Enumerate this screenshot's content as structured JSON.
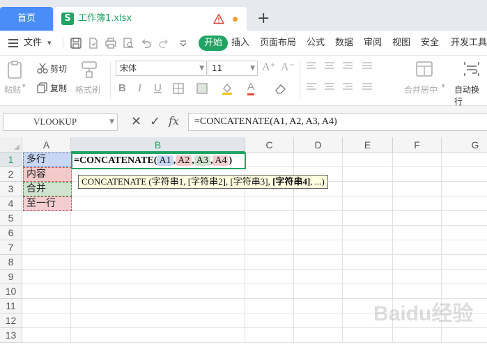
{
  "tabs": {
    "home_label": "首页",
    "doc_title": "工作簿1.xlsx",
    "doc_icon_letter": "S",
    "new_tab_icon": "+"
  },
  "menu": {
    "file_label": "文件",
    "tabs": [
      "开始",
      "插入",
      "页面布局",
      "公式",
      "数据",
      "审阅",
      "视图",
      "安全",
      "开发工具"
    ]
  },
  "ribbon": {
    "paste_label": "粘贴",
    "cut_label": "剪切",
    "copy_label": "复制",
    "format_painter_label": "格式刷",
    "font_name": "宋体",
    "font_size": "11",
    "merge_label": "合并居中",
    "wrap_label": "自动换行"
  },
  "formula_bar": {
    "name_box": "VLOOKUP",
    "fx_label": "fx",
    "formula": "=CONCATENATE(A1, A2, A3, A4)"
  },
  "sheet": {
    "columns": [
      "A",
      "B",
      "C",
      "D",
      "E",
      "F",
      "G"
    ],
    "rows": [
      "1",
      "2",
      "3",
      "4",
      "5",
      "6",
      "7",
      "8",
      "9",
      "10",
      "11",
      "12",
      "13"
    ],
    "cells_A": [
      "多行",
      "内容",
      "合并",
      "至一行"
    ],
    "edit_prefix": "=CONCATENATE(",
    "edit_refs": [
      "A1",
      "A2",
      "A3",
      "A4"
    ],
    "edit_suffix": ")",
    "ref_colors": [
      "#c9d7f5",
      "#f4c9c9",
      "#cfe3cf",
      "#f4cdd0"
    ],
    "tooltip": {
      "func": "CONCATENATE",
      "arg1": "字符串1",
      "arg2": "[字符串2]",
      "arg3": "[字符串3]",
      "arg4": "[字符串4]",
      "tail": "..."
    },
    "watermark": "Baidu经验"
  },
  "colors": {
    "accent": "#1fa463",
    "home_tab": "#4a8df8"
  }
}
